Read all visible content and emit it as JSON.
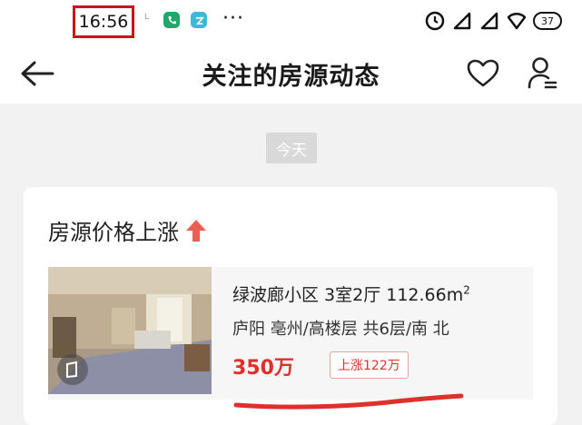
{
  "status_bar": {
    "time": "16:56",
    "small_l": "L",
    "battery": "37"
  },
  "nav": {
    "title": "关注的房源动态"
  },
  "date_chip": "今天",
  "section": {
    "heading": "房源价格上涨"
  },
  "listing": {
    "title": "绿波廊小区 3室2厅 112.66m",
    "title_sup": "2",
    "subtitle": "庐阳 亳州/高楼层 共6层/南 北",
    "price": "350万",
    "change_badge": "上涨122万"
  },
  "colors": {
    "accent_red": "#e0302b",
    "highlight_box": "#c8141e"
  }
}
